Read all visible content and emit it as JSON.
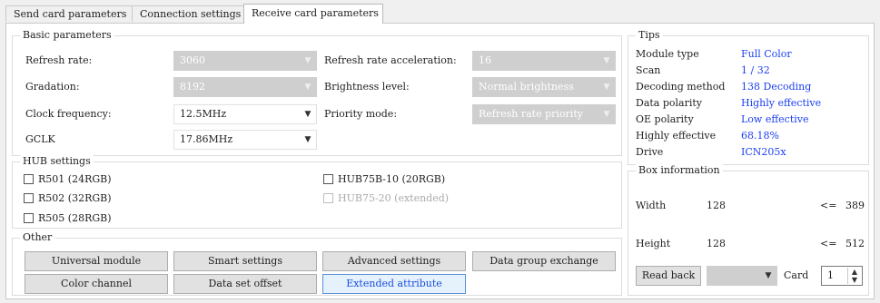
{
  "tabs": [
    {
      "label": "Send card parameters"
    },
    {
      "label": "Connection settings"
    },
    {
      "label": "Receive card parameters"
    }
  ],
  "basic": {
    "title": "Basic parameters",
    "refresh_rate": {
      "label": "Refresh rate:",
      "value": "3060"
    },
    "gradation": {
      "label": "Gradation:",
      "value": "8192"
    },
    "clock_frequency": {
      "label": "Clock frequency:",
      "value": "12.5MHz"
    },
    "gclk": {
      "label": "GCLK",
      "value": "17.86MHz"
    },
    "refresh_rate_acceleration": {
      "label": "Refresh rate acceleration:",
      "value": "16"
    },
    "brightness_level": {
      "label": "Brightness level:",
      "value": "Normal brightness"
    },
    "priority_mode": {
      "label": "Priority mode:",
      "value": "Refresh rate priority"
    }
  },
  "hub": {
    "title": "HUB settings",
    "items": [
      {
        "label": "R501 (24RGB)"
      },
      {
        "label": "R502 (32RGB)"
      },
      {
        "label": "R505 (28RGB)"
      },
      {
        "label": "HUB75B-10 (20RGB)"
      },
      {
        "label": "HUB75-20 (extended)"
      }
    ]
  },
  "other": {
    "title": "Other",
    "buttons": [
      {
        "label": "Universal module"
      },
      {
        "label": "Smart settings"
      },
      {
        "label": "Advanced settings"
      },
      {
        "label": "Data group exchange"
      },
      {
        "label": "Color channel"
      },
      {
        "label": "Data set offset"
      },
      {
        "label": "Extended attribute"
      }
    ]
  },
  "tips": {
    "title": "Tips",
    "rows": [
      {
        "key": "Module type",
        "value": "Full Color"
      },
      {
        "key": "Scan",
        "value": "1 / 32"
      },
      {
        "key": "Decoding method",
        "value": "138 Decoding"
      },
      {
        "key": "Data polarity",
        "value": "Highly effective"
      },
      {
        "key": "OE polarity",
        "value": "Low effective"
      },
      {
        "key": "Highly effective",
        "value": "68.18%"
      },
      {
        "key": "Drive",
        "value": "ICN205x"
      }
    ]
  },
  "box": {
    "title": "Box information",
    "width_label": "Width",
    "width_value": "128",
    "width_limit_op": "<=",
    "width_limit": "389",
    "height_label": "Height",
    "height_value": "128",
    "height_limit_op": "<=",
    "height_limit": "512",
    "read_back_label": "Read back",
    "card_label": "Card",
    "card_value": "1"
  },
  "colors": {
    "tip_value": "#1a3ff0",
    "highlight_button_text": "#1a4fe0",
    "disabled_combo": "#cfcfcf"
  }
}
